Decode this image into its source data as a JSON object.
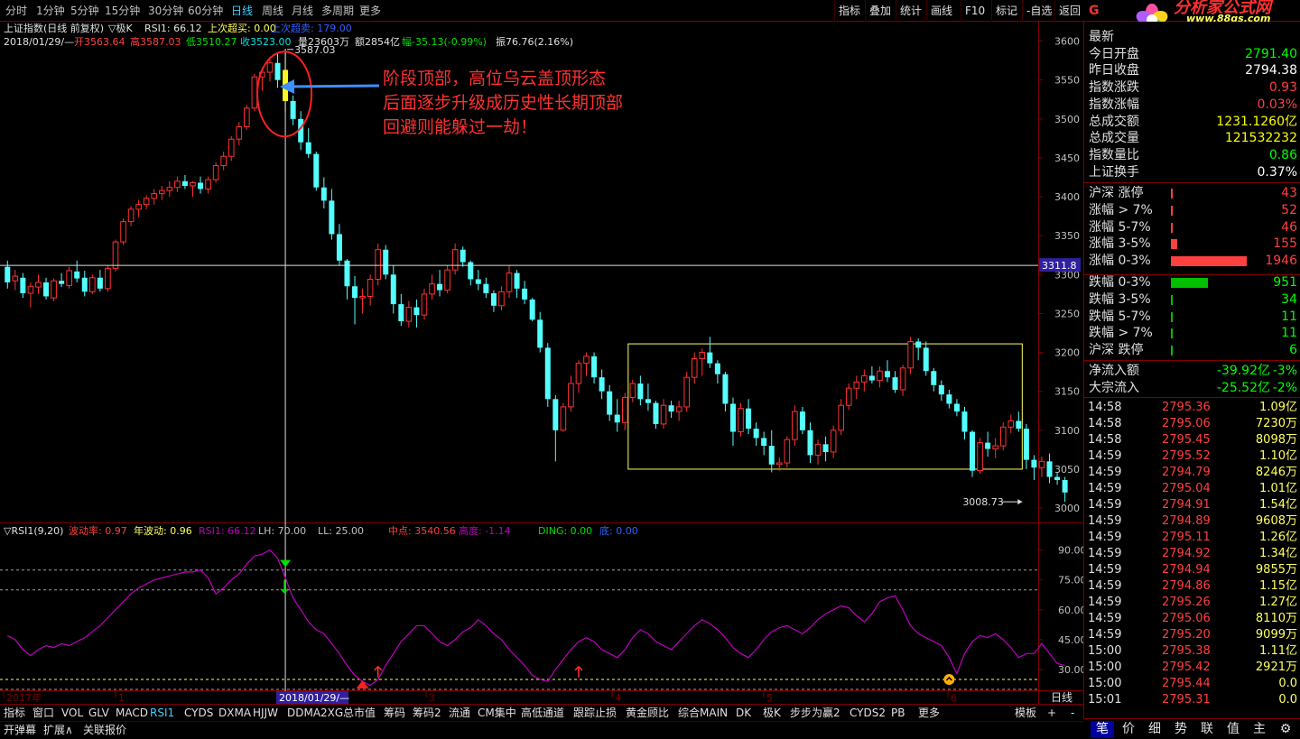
{
  "toolbar": {
    "periods": [
      "分时",
      "1分钟",
      "5分钟",
      "15分钟",
      "30分钟",
      "60分钟",
      "日线",
      "周线",
      "月线",
      "多周期",
      "更多"
    ],
    "active_period": "日线",
    "right_buttons": [
      "指标",
      "叠加",
      "统计",
      "画线",
      "F10",
      "标记",
      "-自选",
      "返回"
    ]
  },
  "logo": {
    "text": "分析家公式网",
    "url_text": "www.88gs.com",
    "letter": "G"
  },
  "header": {
    "line1_title": "上证指数(日线 前复权)",
    "line1_k": "▽极K",
    "line1_rsi": "RSI1: 66.12",
    "line1_over": "上次超买: 0.00",
    "line1_oversell": "上次超卖: 179.00",
    "line2_date": "2018/01/29/—",
    "line2_open": "开3563.64",
    "line2_high": "高3587.03",
    "line2_low": "低3510.27",
    "line2_close": "收3523.00",
    "line2_vol": "量23603万",
    "line2_amt": "额2854亿",
    "line2_chg": "幅-35.13(-0.99%)",
    "line2_amp": "振76.76(2.16%)"
  },
  "annotation": {
    "lines": [
      "阶段顶部，高位乌云盖顶形态",
      "后面逐步升级成历史性长期顶部",
      "回避则能躲过一劫！"
    ],
    "high_label": "3587.03",
    "low_label": "3008.73",
    "cursor_price": "3311.8"
  },
  "price_axis": [
    "3600",
    "3550",
    "3500",
    "3450",
    "3400",
    "3350",
    "3300",
    "3250",
    "3200",
    "3150",
    "3100",
    "3050",
    "3000"
  ],
  "rsi_header": {
    "title": "▽RSI1(9,20)",
    "volatility": "波动率: 0.97",
    "annual_vol": "年波动: 0.96",
    "rsi": "RSI1: 66.12",
    "lh": "LH: 70.00",
    "ll": "LL: 25.00",
    "mid": "中点: 3540.56",
    "height": "高度: -1.14",
    "ding": "DING: 0.00",
    "di": "底: 0.00"
  },
  "rsi_axis": [
    "90.00",
    "75.00",
    "60.00",
    "45.00",
    "30.00"
  ],
  "date_axis": {
    "labels": [
      "2017年",
      "1",
      "2018/01/29/—",
      "3",
      "4",
      "5",
      "6"
    ],
    "period": "日线"
  },
  "indicator_tabs": [
    "指标",
    "窗口",
    "VOL",
    "GLV",
    "MACD",
    "RSI1",
    "CYDS",
    "DXMA",
    "HJJW",
    "DDMA2XG",
    "总市值",
    "筹码",
    "筹码2",
    "流通",
    "CM集中",
    "高低通道",
    "跟踪止损",
    "黄金顾比",
    "综合MAIN",
    "DK",
    "极K",
    "步步为赢2",
    "CYDS2",
    "PB",
    "更多"
  ],
  "indicator_active": "RSI1",
  "indicator_right": [
    "模板",
    "+",
    "-"
  ],
  "bottom_bar": [
    "开弹幕",
    "扩展∧",
    "关联报价"
  ],
  "stats": [
    {
      "label": "最新",
      "value": "",
      "color": "#ff4040"
    },
    {
      "label": "今日开盘",
      "value": "2791.40",
      "color": "#00ff00"
    },
    {
      "label": "昨日收盘",
      "value": "2794.38",
      "color": "#ffffff"
    },
    {
      "label": "指数涨跌",
      "value": "0.93",
      "color": "#ff4040"
    },
    {
      "label": "指数涨幅",
      "value": "0.03%",
      "color": "#ff4040"
    },
    {
      "label": "总成交额",
      "value": "1231.1260亿",
      "color": "#ffff00"
    },
    {
      "label": "总成交量",
      "value": "121532232",
      "color": "#ffff00"
    },
    {
      "label": "指数量比",
      "value": "0.86",
      "color": "#00ff00"
    },
    {
      "label": "上证换手",
      "value": "0.37%",
      "color": "#ffffff"
    }
  ],
  "breadth": [
    {
      "label": "沪深 涨停",
      "value": "43",
      "color": "#ff4040",
      "bar": 0.01
    },
    {
      "label": "涨幅 > 7%",
      "value": "52",
      "color": "#ff4040",
      "bar": 0.02
    },
    {
      "label": "涨幅 5-7%",
      "value": "46",
      "color": "#ff4040",
      "bar": 0.01
    },
    {
      "label": "涨幅 3-5%",
      "value": "155",
      "color": "#ff4040",
      "bar": 0.08
    },
    {
      "label": "涨幅 0-3%",
      "value": "1946",
      "color": "#ff4040",
      "bar": 1.0
    },
    {
      "label": "跌幅 0-3%",
      "value": "951",
      "color": "#00ff00",
      "bar": 0.49
    },
    {
      "label": "跌幅 3-5%",
      "value": "34",
      "color": "#00ff00",
      "bar": 0.01
    },
    {
      "label": "跌幅 5-7%",
      "value": "11",
      "color": "#00ff00",
      "bar": 0.01
    },
    {
      "label": "跌幅 > 7%",
      "value": "11",
      "color": "#00ff00",
      "bar": 0.01
    },
    {
      "label": "沪深 跌停",
      "value": "6",
      "color": "#00ff00",
      "bar": 0.01
    }
  ],
  "flows": [
    {
      "label": "净流入额",
      "value": "-39.92亿",
      "pct": "-3%"
    },
    {
      "label": "大宗流入",
      "value": "-25.52亿",
      "pct": "-2%"
    }
  ],
  "ticks": [
    {
      "t": "14:58",
      "p": "2795.36",
      "v": "1.09亿"
    },
    {
      "t": "14:58",
      "p": "2795.06",
      "v": "7230万"
    },
    {
      "t": "14:58",
      "p": "2795.45",
      "v": "8098万"
    },
    {
      "t": "14:59",
      "p": "2795.52",
      "v": "1.10亿"
    },
    {
      "t": "14:59",
      "p": "2794.79",
      "v": "8246万"
    },
    {
      "t": "14:59",
      "p": "2795.04",
      "v": "1.01亿"
    },
    {
      "t": "14:59",
      "p": "2794.91",
      "v": "1.54亿"
    },
    {
      "t": "14:59",
      "p": "2794.89",
      "v": "9608万"
    },
    {
      "t": "14:59",
      "p": "2795.11",
      "v": "1.26亿"
    },
    {
      "t": "14:59",
      "p": "2794.92",
      "v": "1.34亿"
    },
    {
      "t": "14:59",
      "p": "2794.94",
      "v": "9855万"
    },
    {
      "t": "14:59",
      "p": "2794.86",
      "v": "1.15亿"
    },
    {
      "t": "14:59",
      "p": "2795.26",
      "v": "1.27亿"
    },
    {
      "t": "14:59",
      "p": "2795.06",
      "v": "8110万"
    },
    {
      "t": "14:59",
      "p": "2795.20",
      "v": "9099万"
    },
    {
      "t": "15:00",
      "p": "2795.38",
      "v": "1.11亿"
    },
    {
      "t": "15:00",
      "p": "2795.42",
      "v": "2921万"
    },
    {
      "t": "15:00",
      "p": "2795.44",
      "v": "0.0"
    },
    {
      "t": "15:01",
      "p": "2795.31",
      "v": "0.0"
    }
  ],
  "right_tabs": [
    "笔",
    "价",
    "细",
    "势",
    "联",
    "值",
    "主",
    "⚙"
  ],
  "colors": {
    "up": "#ff3232",
    "down": "#54ffff",
    "rsi": "#c000c0",
    "box": "#ffff60",
    "frame": "#800000"
  },
  "chart_data": {
    "type": "candlestick",
    "price_range": [
      2985,
      3625
    ],
    "rsi_range": [
      20,
      98
    ],
    "candles": [
      [
        3310,
        3318,
        3282,
        3290
      ],
      [
        3292,
        3306,
        3280,
        3298
      ],
      [
        3296,
        3302,
        3270,
        3276
      ],
      [
        3276,
        3290,
        3258,
        3285
      ],
      [
        3284,
        3300,
        3275,
        3290
      ],
      [
        3290,
        3296,
        3268,
        3272
      ],
      [
        3270,
        3295,
        3266,
        3292
      ],
      [
        3292,
        3302,
        3284,
        3288
      ],
      [
        3286,
        3310,
        3282,
        3305
      ],
      [
        3304,
        3318,
        3290,
        3295
      ],
      [
        3296,
        3305,
        3272,
        3278
      ],
      [
        3278,
        3300,
        3275,
        3296
      ],
      [
        3296,
        3306,
        3278,
        3282
      ],
      [
        3282,
        3312,
        3278,
        3308
      ],
      [
        3308,
        3345,
        3304,
        3342
      ],
      [
        3342,
        3372,
        3338,
        3368
      ],
      [
        3368,
        3388,
        3362,
        3384
      ],
      [
        3384,
        3396,
        3374,
        3390
      ],
      [
        3390,
        3402,
        3384,
        3398
      ],
      [
        3398,
        3410,
        3390,
        3404
      ],
      [
        3404,
        3414,
        3396,
        3408
      ],
      [
        3408,
        3420,
        3400,
        3412
      ],
      [
        3412,
        3426,
        3406,
        3420
      ],
      [
        3420,
        3428,
        3410,
        3414
      ],
      [
        3414,
        3420,
        3400,
        3418
      ],
      [
        3418,
        3426,
        3404,
        3410
      ],
      [
        3410,
        3426,
        3404,
        3422
      ],
      [
        3422,
        3444,
        3418,
        3440
      ],
      [
        3440,
        3458,
        3434,
        3452
      ],
      [
        3452,
        3478,
        3446,
        3474
      ],
      [
        3474,
        3496,
        3466,
        3490
      ],
      [
        3490,
        3518,
        3486,
        3514
      ],
      [
        3514,
        3558,
        3510,
        3554
      ],
      [
        3554,
        3566,
        3536,
        3560
      ],
      [
        3560,
        3580,
        3548,
        3572
      ],
      [
        3572,
        3584,
        3540,
        3550
      ],
      [
        3563,
        3587,
        3510,
        3523
      ],
      [
        3523,
        3530,
        3492,
        3500
      ],
      [
        3500,
        3510,
        3460,
        3470
      ],
      [
        3470,
        3488,
        3450,
        3455
      ],
      [
        3455,
        3458,
        3408,
        3412
      ],
      [
        3412,
        3425,
        3385,
        3395
      ],
      [
        3395,
        3410,
        3345,
        3352
      ],
      [
        3352,
        3365,
        3312,
        3318
      ],
      [
        3318,
        3320,
        3268,
        3285
      ],
      [
        3285,
        3298,
        3236,
        3270
      ],
      [
        3270,
        3282,
        3250,
        3272
      ],
      [
        3272,
        3300,
        3260,
        3294
      ],
      [
        3294,
        3340,
        3286,
        3332
      ],
      [
        3332,
        3338,
        3294,
        3300
      ],
      [
        3300,
        3312,
        3250,
        3262
      ],
      [
        3262,
        3275,
        3234,
        3240
      ],
      [
        3240,
        3266,
        3232,
        3258
      ],
      [
        3258,
        3268,
        3232,
        3248
      ],
      [
        3248,
        3282,
        3242,
        3275
      ],
      [
        3275,
        3300,
        3268,
        3288
      ],
      [
        3288,
        3306,
        3272,
        3280
      ],
      [
        3280,
        3312,
        3276,
        3306
      ],
      [
        3306,
        3340,
        3300,
        3332
      ],
      [
        3332,
        3336,
        3310,
        3316
      ],
      [
        3316,
        3318,
        3286,
        3294
      ],
      [
        3294,
        3306,
        3280,
        3288
      ],
      [
        3288,
        3296,
        3270,
        3276
      ],
      [
        3276,
        3280,
        3252,
        3260
      ],
      [
        3260,
        3285,
        3254,
        3278
      ],
      [
        3278,
        3312,
        3270,
        3302
      ],
      [
        3302,
        3306,
        3270,
        3282
      ],
      [
        3282,
        3292,
        3262,
        3268
      ],
      [
        3268,
        3270,
        3240,
        3242
      ],
      [
        3242,
        3252,
        3200,
        3206
      ],
      [
        3206,
        3212,
        3130,
        3140
      ],
      [
        3140,
        3145,
        3060,
        3100
      ],
      [
        3100,
        3135,
        3098,
        3130
      ],
      [
        3130,
        3170,
        3124,
        3160
      ],
      [
        3160,
        3190,
        3148,
        3186
      ],
      [
        3186,
        3200,
        3170,
        3195
      ],
      [
        3195,
        3200,
        3160,
        3168
      ],
      [
        3168,
        3178,
        3140,
        3150
      ],
      [
        3150,
        3158,
        3112,
        3120
      ],
      [
        3120,
        3140,
        3098,
        3110
      ],
      [
        3110,
        3148,
        3100,
        3142
      ],
      [
        3142,
        3165,
        3136,
        3160
      ],
      [
        3160,
        3170,
        3132,
        3140
      ],
      [
        3140,
        3160,
        3125,
        3135
      ],
      [
        3135,
        3138,
        3102,
        3108
      ],
      [
        3108,
        3140,
        3102,
        3132
      ],
      [
        3132,
        3138,
        3116,
        3124
      ],
      [
        3124,
        3138,
        3112,
        3130
      ],
      [
        3130,
        3175,
        3124,
        3168
      ],
      [
        3168,
        3200,
        3160,
        3192
      ],
      [
        3192,
        3205,
        3170,
        3200
      ],
      [
        3200,
        3220,
        3180,
        3186
      ],
      [
        3186,
        3190,
        3160,
        3172
      ],
      [
        3172,
        3175,
        3124,
        3134
      ],
      [
        3134,
        3142,
        3080,
        3098
      ],
      [
        3098,
        3135,
        3092,
        3128
      ],
      [
        3128,
        3140,
        3095,
        3102
      ],
      [
        3102,
        3110,
        3080,
        3090
      ],
      [
        3090,
        3098,
        3068,
        3080
      ],
      [
        3080,
        3100,
        3046,
        3056
      ],
      [
        3056,
        3065,
        3048,
        3058
      ],
      [
        3058,
        3092,
        3052,
        3088
      ],
      [
        3088,
        3132,
        3080,
        3124
      ],
      [
        3124,
        3130,
        3095,
        3100
      ],
      [
        3100,
        3110,
        3058,
        3068
      ],
      [
        3068,
        3088,
        3056,
        3082
      ],
      [
        3082,
        3092,
        3060,
        3072
      ],
      [
        3072,
        3106,
        3064,
        3100
      ],
      [
        3100,
        3140,
        3094,
        3132
      ],
      [
        3132,
        3160,
        3126,
        3154
      ],
      [
        3154,
        3170,
        3140,
        3162
      ],
      [
        3162,
        3178,
        3150,
        3170
      ],
      [
        3170,
        3182,
        3160,
        3164
      ],
      [
        3164,
        3182,
        3155,
        3176
      ],
      [
        3176,
        3190,
        3162,
        3168
      ],
      [
        3168,
        3176,
        3148,
        3152
      ],
      [
        3152,
        3184,
        3144,
        3180
      ],
      [
        3180,
        3220,
        3172,
        3214
      ],
      [
        3214,
        3218,
        3190,
        3206
      ],
      [
        3206,
        3214,
        3170,
        3176
      ],
      [
        3176,
        3180,
        3150,
        3158
      ],
      [
        3158,
        3164,
        3138,
        3146
      ],
      [
        3146,
        3152,
        3128,
        3134
      ],
      [
        3134,
        3140,
        3118,
        3124
      ],
      [
        3124,
        3130,
        3088,
        3098
      ],
      [
        3098,
        3100,
        3040,
        3048
      ],
      [
        3048,
        3090,
        3044,
        3084
      ],
      [
        3084,
        3098,
        3066,
        3076
      ],
      [
        3076,
        3090,
        3064,
        3080
      ],
      [
        3080,
        3110,
        3074,
        3104
      ],
      [
        3104,
        3120,
        3096,
        3112
      ],
      [
        3112,
        3124,
        3098,
        3102
      ],
      [
        3102,
        3108,
        3050,
        3062
      ],
      [
        3062,
        3068,
        3036,
        3052
      ],
      [
        3052,
        3066,
        3040,
        3060
      ],
      [
        3060,
        3070,
        3032,
        3040
      ],
      [
        3040,
        3046,
        3030,
        3036
      ],
      [
        3036,
        3040,
        3008,
        3020
      ]
    ],
    "rsi": [
      47,
      45,
      40,
      37,
      40,
      42,
      41,
      43,
      42,
      44,
      46,
      49,
      52,
      56,
      60,
      64,
      68,
      71,
      73,
      75,
      76,
      77,
      78,
      79,
      79,
      80,
      76,
      68,
      71,
      75,
      78,
      83,
      87,
      88,
      90,
      86,
      76,
      66,
      60,
      54,
      50,
      48,
      43,
      38,
      32,
      27,
      24,
      22,
      25,
      32,
      38,
      44,
      48,
      52,
      52,
      48,
      44,
      42,
      45,
      49,
      51,
      55,
      52,
      48,
      45,
      40,
      36,
      32,
      27,
      25,
      24,
      30,
      35,
      40,
      44,
      46,
      44,
      40,
      38,
      36,
      40,
      46,
      50,
      48,
      44,
      42,
      40,
      44,
      48,
      52,
      55,
      53,
      50,
      46,
      41,
      38,
      36,
      40,
      45,
      49,
      51,
      52,
      50,
      48,
      51,
      55,
      58,
      60,
      62,
      61,
      57,
      54,
      58,
      64,
      66,
      67,
      60,
      52,
      48,
      46,
      44,
      42,
      36,
      28,
      38,
      44,
      47,
      46,
      48,
      45,
      41,
      36,
      38,
      38,
      43,
      38,
      33,
      32
    ]
  }
}
